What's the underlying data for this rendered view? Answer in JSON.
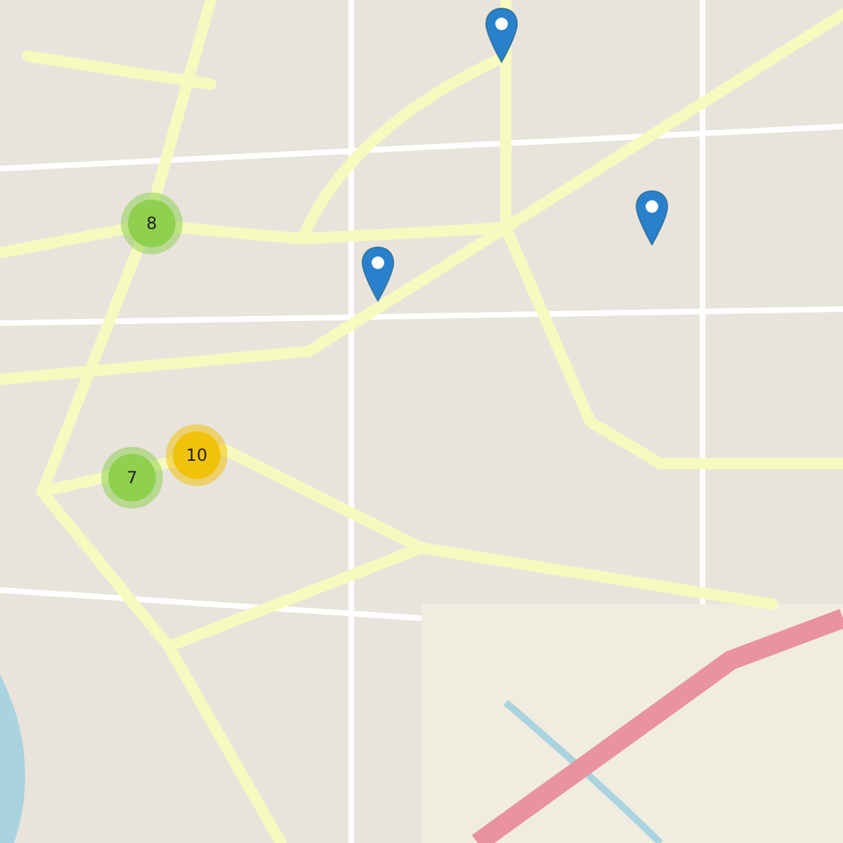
{
  "clusters": [
    {
      "count": "8",
      "color": "#8fd14f"
    },
    {
      "count": "10",
      "color": "#f0c20c"
    },
    {
      "count": "7",
      "color": "#8fd14f"
    }
  ]
}
